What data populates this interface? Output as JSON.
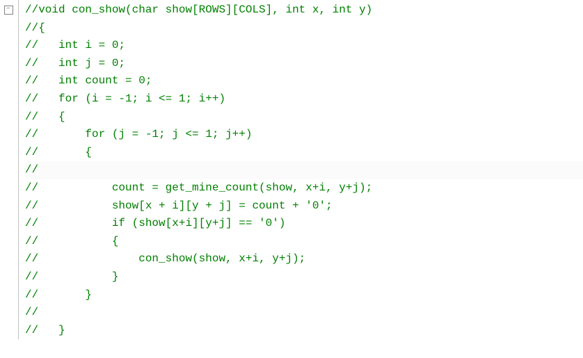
{
  "gutter": {
    "fold_symbol": "−"
  },
  "code": {
    "lines": [
      {
        "segments": [
          {
            "cls": "comment",
            "text": "//void con_show(char show[ROWS][COLS], int x, int y)"
          }
        ]
      },
      {
        "segments": [
          {
            "cls": "comment",
            "text": "//{"
          }
        ]
      },
      {
        "segments": [
          {
            "cls": "comment",
            "text": "//   int i = 0;"
          }
        ]
      },
      {
        "segments": [
          {
            "cls": "comment",
            "text": "//   int j = 0;"
          }
        ]
      },
      {
        "segments": [
          {
            "cls": "comment",
            "text": "//   int count = 0;"
          }
        ]
      },
      {
        "segments": [
          {
            "cls": "comment",
            "text": "//   for (i = -1; i <= 1; i++)"
          }
        ]
      },
      {
        "segments": [
          {
            "cls": "comment",
            "text": "//   {"
          }
        ]
      },
      {
        "segments": [
          {
            "cls": "comment",
            "text": "//       for (j = -1; j <= 1; j++)"
          }
        ]
      },
      {
        "segments": [
          {
            "cls": "comment",
            "text": "//       {"
          }
        ]
      },
      {
        "highlight": true,
        "segments": [
          {
            "cls": "comment",
            "text": "//"
          }
        ]
      },
      {
        "segments": [
          {
            "cls": "comment",
            "text": "//           count = get_mine_count(show, x+i, y+j);"
          }
        ]
      },
      {
        "segments": [
          {
            "cls": "comment",
            "text": "//           show[x + i][y + j] = count + '0';"
          }
        ]
      },
      {
        "segments": [
          {
            "cls": "comment",
            "text": "//           if (show[x+i][y+j] == '0')"
          }
        ]
      },
      {
        "segments": [
          {
            "cls": "comment",
            "text": "//           {"
          }
        ]
      },
      {
        "segments": [
          {
            "cls": "comment",
            "text": "//               con_show(show, x+i, y+j);"
          }
        ]
      },
      {
        "segments": [
          {
            "cls": "comment",
            "text": "//           }"
          }
        ]
      },
      {
        "segments": [
          {
            "cls": "comment",
            "text": "//       }"
          }
        ]
      },
      {
        "segments": [
          {
            "cls": "comment",
            "text": "//"
          }
        ]
      },
      {
        "segments": [
          {
            "cls": "comment",
            "text": "//   }"
          }
        ]
      }
    ]
  }
}
